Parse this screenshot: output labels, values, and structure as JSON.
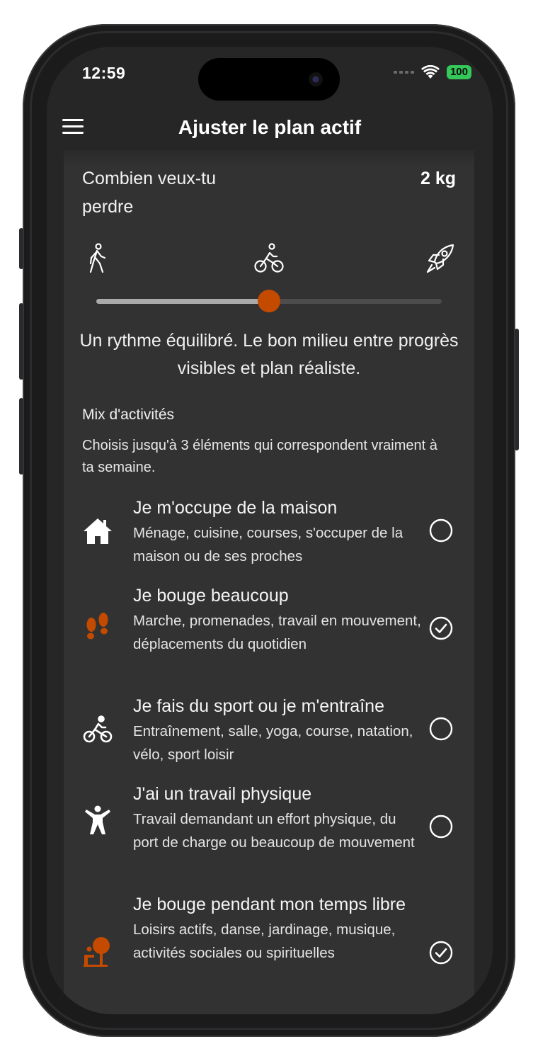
{
  "status_bar": {
    "time": "12:59",
    "battery": "100"
  },
  "header": {
    "title": "Ajuster le plan actif"
  },
  "goal": {
    "question": "Combien veux-tu perdre",
    "value": "2 kg"
  },
  "pace": {
    "icons": [
      "walking-icon",
      "bicycle-icon",
      "rocket-icon"
    ],
    "level": 0.5,
    "description": "Un rythme équilibré. Le bon milieu entre progrès visibles et plan réaliste."
  },
  "activity_mix": {
    "title": "Mix d'activités",
    "help": "Choisis jusqu'à 3 éléments qui correspondent vraiment à ta semaine.",
    "items": [
      {
        "icon": "house-icon",
        "title": "Je m'occupe de la maison",
        "description": "Ménage, cuisine, courses, s'occuper de la maison ou de ses proches",
        "selected": false
      },
      {
        "icon": "footprints-icon",
        "title": "Je bouge beaucoup",
        "description": "Marche, promenades, travail en mouvement, déplacements du quotidien",
        "selected": true
      },
      {
        "icon": "bicycle-icon",
        "title": "Je fais du sport ou je m'entraîne",
        "description": "Entraînement, salle, yoga, course, natation, vélo, sport loisir",
        "selected": false
      },
      {
        "icon": "person-arms-up-icon",
        "title": "J'ai un travail physique",
        "description": "Travail demandant un effort physique, du port de charge ou beaucoup de mouvement",
        "selected": false
      },
      {
        "icon": "leisure-tree-icon",
        "title": "Je bouge pendant mon temps libre",
        "description": "Loisirs actifs, danse, jardinage, musique, activités sociales ou spirituelles",
        "selected": true
      }
    ]
  },
  "colors": {
    "accent": "#c44a00",
    "background": "#262626",
    "card": "#323232",
    "battery": "#34c759"
  }
}
